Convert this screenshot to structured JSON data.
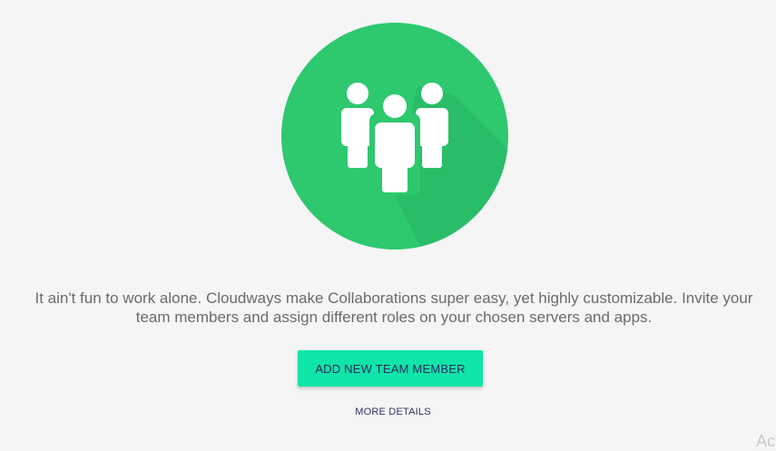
{
  "hero": {
    "icon": "team-group-icon",
    "circle_color": "#2ec86e",
    "figure_color": "#ffffff"
  },
  "description": {
    "line1": "It ain't fun to work alone. Cloudways make Collaborations super easy, yet highly customizable. Invite your",
    "line2": "team members and assign different roles on your chosen servers and apps."
  },
  "actions": {
    "add_member_label": "ADD NEW TEAM MEMBER",
    "add_member_color": "#0fe5a9",
    "more_details_label": "MORE DETAILS"
  },
  "watermark": {
    "text": "Ac"
  }
}
